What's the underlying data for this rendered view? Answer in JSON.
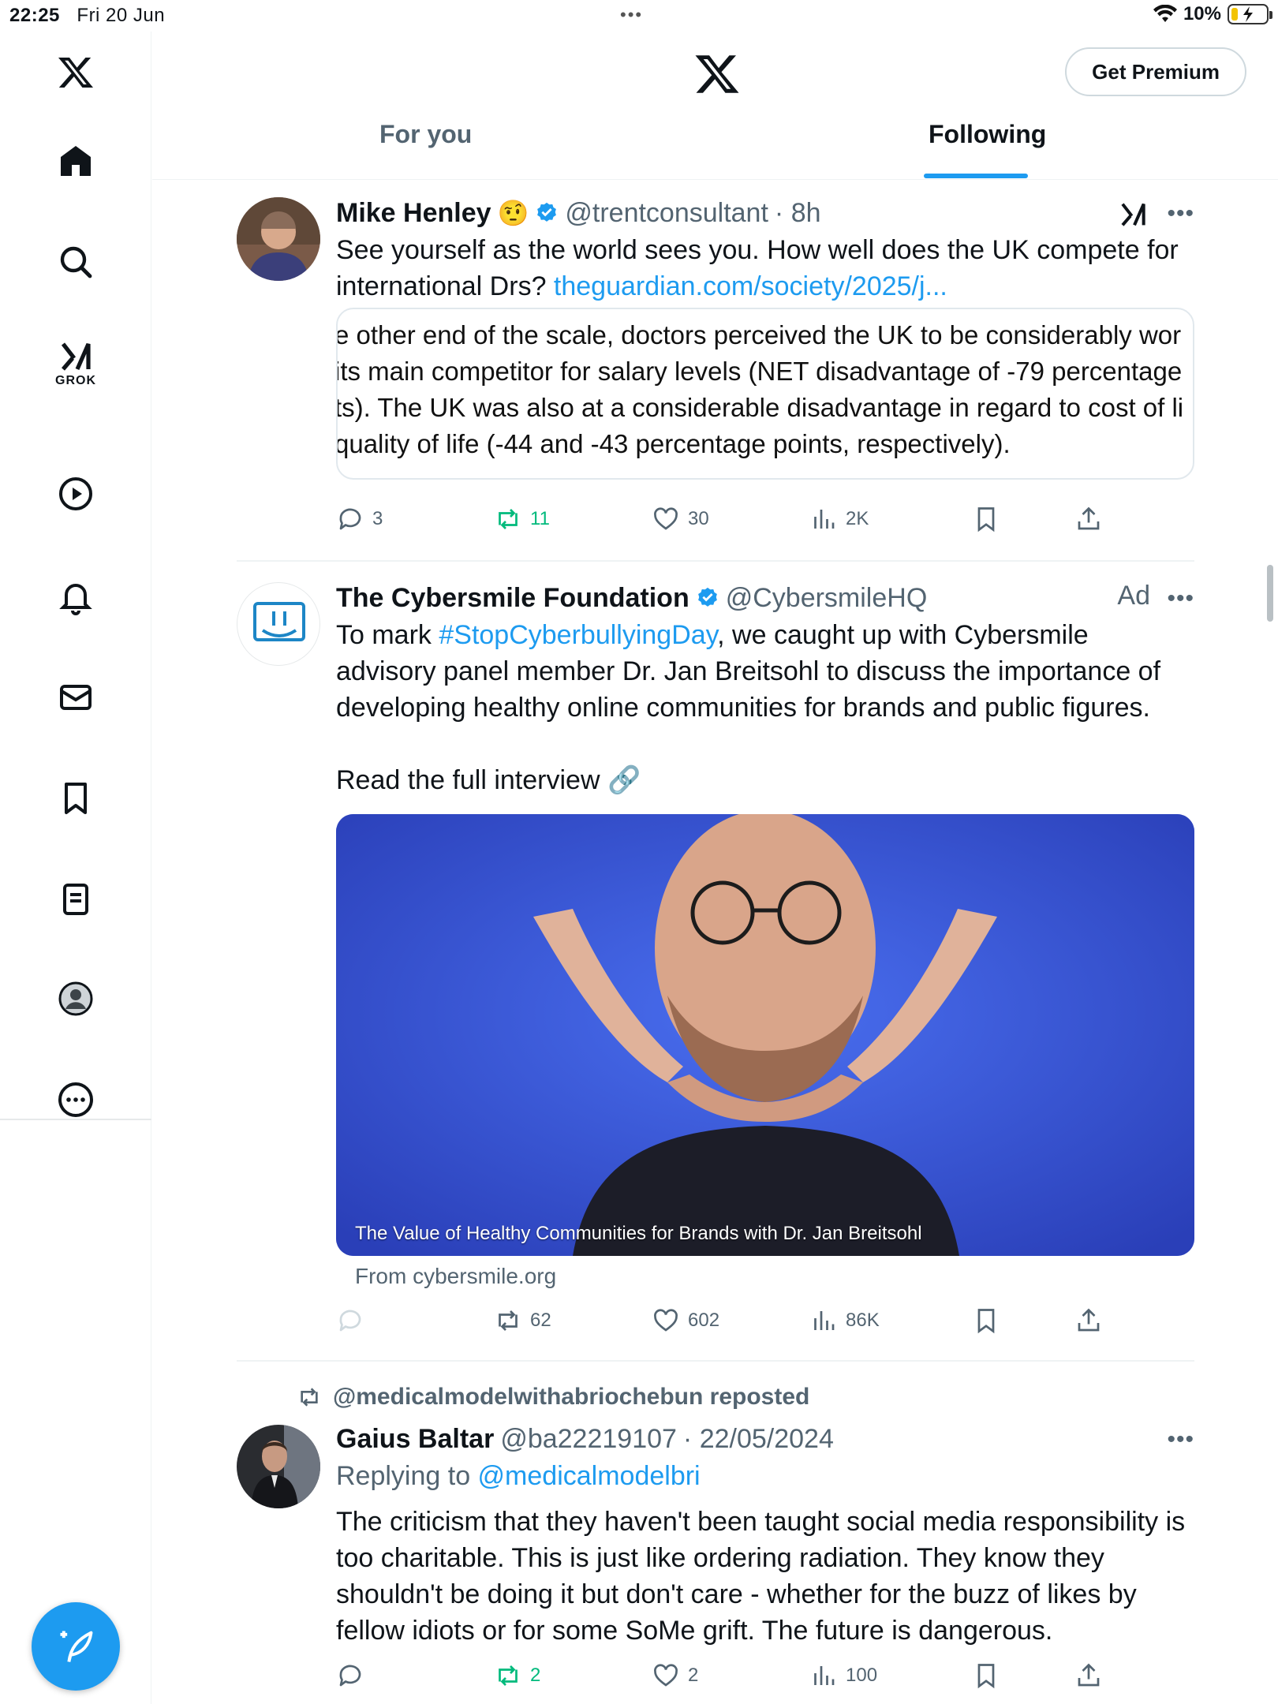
{
  "status_bar": {
    "time": "22:25",
    "date": "Fri 20 Jun",
    "dots": "•••",
    "wifi_icon": "wifi-icon",
    "battery_percent": "10%",
    "battery_level": 0.1
  },
  "sidebar": {
    "items": [
      {
        "name": "x-logo",
        "icon": "x-logo-icon"
      },
      {
        "name": "home",
        "icon": "home-icon"
      },
      {
        "name": "search",
        "icon": "search-icon"
      },
      {
        "name": "grok",
        "icon": "grok-icon",
        "label": "GROK"
      },
      {
        "name": "video",
        "icon": "play-icon"
      },
      {
        "name": "notifications",
        "icon": "bell-icon"
      },
      {
        "name": "messages",
        "icon": "mail-icon"
      },
      {
        "name": "bookmarks",
        "icon": "bookmark-icon"
      },
      {
        "name": "lists",
        "icon": "list-icon"
      },
      {
        "name": "profile",
        "icon": "profile-icon"
      },
      {
        "name": "more",
        "icon": "more-circle-icon"
      }
    ],
    "compose_icon": "compose-icon"
  },
  "header": {
    "logo_icon": "x-logo-icon",
    "premium_label": "Get Premium",
    "tabs": [
      {
        "label": "For you",
        "active": false
      },
      {
        "label": "Following",
        "active": true
      }
    ]
  },
  "colors": {
    "accent": "#1d9bf0",
    "repost_green": "#00ba7c",
    "secondary_text": "#536471",
    "media_blue": "#3a5ad6"
  },
  "posts": [
    {
      "name": "Mike Henley",
      "emoji": "🤨",
      "handle": "@trentconsultant",
      "time": "· 8h",
      "text": "See yourself as the world sees you. How well does the UK compete for international Drs? ",
      "link": "theguardian.com/society/2025/j...",
      "quote_lines": [
        "e other end of the scale, doctors perceived the UK to be considerably wor",
        " its main competitor for salary levels (NET disadvantage of -79 percentage",
        "ts). The UK was also at a considerable disadvantage in regard to cost of li",
        "quality of life (-44 and -43 percentage points, respectively)."
      ],
      "stats": {
        "replies": "3",
        "reposts": "11",
        "likes": "30",
        "views": "2K"
      }
    },
    {
      "name": "The Cybersmile Foundation",
      "handle": "@CybersmileHQ",
      "ad_label": "Ad",
      "text_before": "To mark ",
      "hashtag": "#StopCyberbullyingDay",
      "text_after": ", we caught up with Cybersmile advisory panel member Dr. Jan Breitsohl to discuss the importance of developing healthy online communities for brands and public figures.",
      "text_line2": "Read the full interview 🔗",
      "media_caption": "The Value of Healthy Communities for Brands with Dr. Jan Breitsohl",
      "media_source": "From cybersmile.org",
      "stats": {
        "replies": "",
        "reposts": "62",
        "likes": "602",
        "views": "86K"
      }
    },
    {
      "repost_by": "@medicalmodelwithabriochebun reposted",
      "name": "Gaius Baltar",
      "handle": "@ba22219107",
      "time": "· 22/05/2024",
      "replying_prefix": "Replying to ",
      "replying_handle": "@medicalmodelbri",
      "text": "The criticism that they haven't been taught social media responsibility is too charitable. This is just like ordering radiation. They know they shouldn't be doing it but don't care - whether for the buzz of likes by fellow idiots or for some SoMe grift. The future is dangerous.",
      "stats": {
        "replies": "",
        "reposts": "2",
        "likes": "2",
        "views": "100"
      }
    }
  ]
}
